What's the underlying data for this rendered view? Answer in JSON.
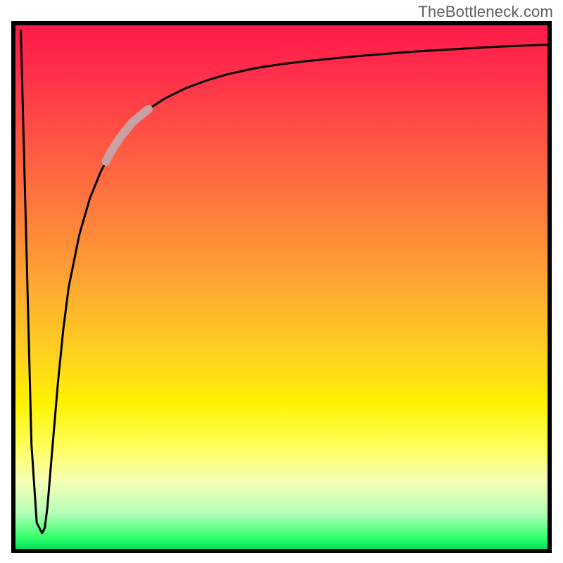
{
  "attribution": "TheBottleneck.com",
  "chart_data": {
    "type": "line",
    "title": "",
    "xlabel": "",
    "ylabel": "",
    "xlim": [
      0,
      100
    ],
    "ylim": [
      0,
      100
    ],
    "gradient_stops": [
      {
        "pos": 0,
        "color": "#ff1a4a"
      },
      {
        "pos": 9,
        "color": "#ff2e4a"
      },
      {
        "pos": 22,
        "color": "#ff5543"
      },
      {
        "pos": 36,
        "color": "#ff7e3c"
      },
      {
        "pos": 50,
        "color": "#ffa931"
      },
      {
        "pos": 63,
        "color": "#ffd21f"
      },
      {
        "pos": 72,
        "color": "#fff200"
      },
      {
        "pos": 80,
        "color": "#ffff55"
      },
      {
        "pos": 87,
        "color": "#f6ffb5"
      },
      {
        "pos": 93,
        "color": "#b8ffb8"
      },
      {
        "pos": 98,
        "color": "#2eff6a"
      },
      {
        "pos": 100,
        "color": "#00e060"
      }
    ],
    "highlight_segment": {
      "x_start": 17,
      "x_end": 25,
      "color": "#caa0a0"
    },
    "series": [
      {
        "name": "curve",
        "x": [
          1,
          2,
          3,
          4,
          5,
          5.5,
          6,
          7,
          8,
          9,
          10,
          12,
          14,
          16,
          18,
          20,
          22,
          25,
          28,
          32,
          36,
          40,
          45,
          50,
          55,
          60,
          65,
          70,
          75,
          80,
          85,
          90,
          95,
          100
        ],
        "y": [
          99,
          60,
          20,
          5,
          3,
          4,
          8,
          20,
          32,
          42,
          50,
          60,
          67,
          72,
          76,
          79,
          81.5,
          84,
          86,
          88,
          89.5,
          90.7,
          91.8,
          92.6,
          93.2,
          93.7,
          94.2,
          94.6,
          95,
          95.3,
          95.6,
          95.9,
          96.1,
          96.3
        ]
      }
    ]
  }
}
